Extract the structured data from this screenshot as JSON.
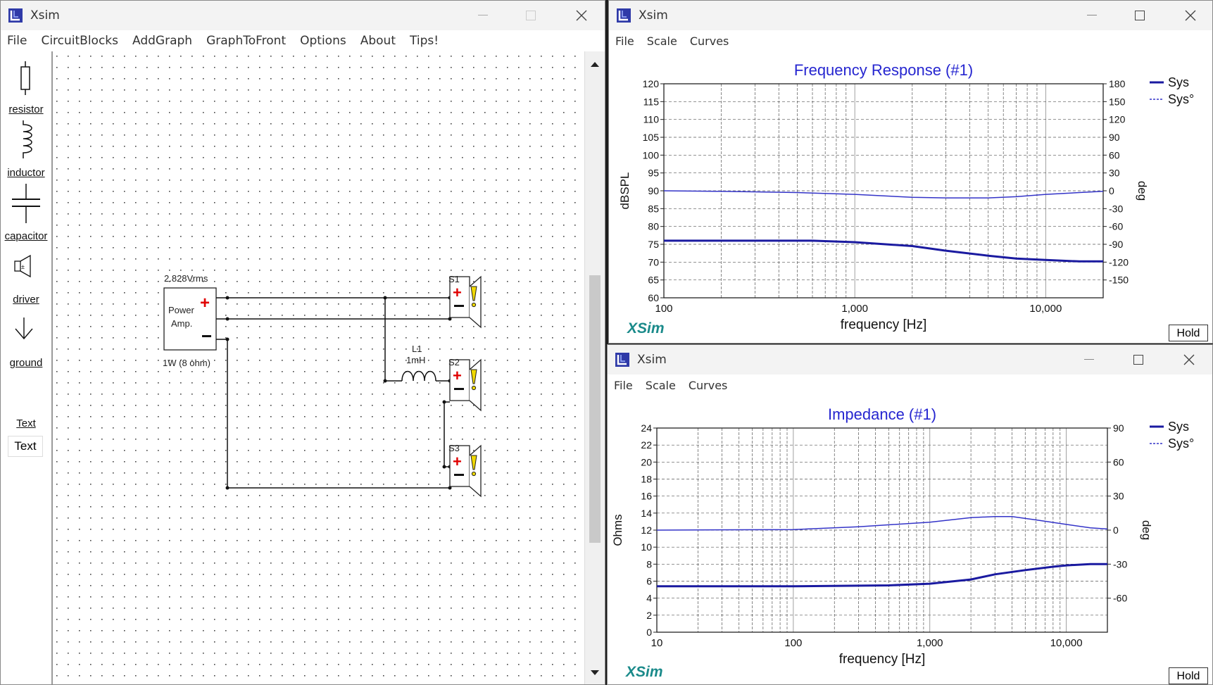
{
  "schematic": {
    "title": "Xsim",
    "menu": [
      "File",
      "CircuitBlocks",
      "AddGraph",
      "GraphToFront",
      "Options",
      "About",
      "Tips!"
    ],
    "palette": [
      {
        "label": "resistor",
        "icon": "resistor-icon"
      },
      {
        "label": "inductor",
        "icon": "inductor-icon"
      },
      {
        "label": "capacitor",
        "icon": "capacitor-icon"
      },
      {
        "label": "driver",
        "icon": "driver-icon"
      },
      {
        "label": "ground",
        "icon": "ground-icon"
      },
      {
        "label": "Text",
        "icon": "text-box"
      },
      {
        "label": "Text",
        "icon": ""
      }
    ],
    "amp": {
      "voltage": "2.828Vrms",
      "line1": "Power",
      "line2": "Amp.",
      "power": "1W (8 ohm)"
    },
    "inductor": {
      "name": "L1",
      "value": "1mH"
    },
    "speakers": [
      "S1",
      "S2",
      "S3"
    ]
  },
  "freq_window": {
    "title": "Xsim",
    "menu": [
      "File",
      "Scale",
      "Curves"
    ],
    "hold_label": "Hold",
    "brand": "XSim"
  },
  "imp_window": {
    "title": "Xsim",
    "menu": [
      "File",
      "Scale",
      "Curves"
    ],
    "hold_label": "Hold",
    "brand": "XSim"
  },
  "chart_data": [
    {
      "type": "line",
      "title": "Frequency Response (#1)",
      "xlabel": "frequency [Hz]",
      "ylabel": "dBSPL",
      "y2label": "deg",
      "xscale": "log",
      "xlim": [
        100,
        20000
      ],
      "ylim": [
        60,
        120
      ],
      "y2lim": [
        -180,
        180
      ],
      "xticks": [
        100,
        1000,
        10000
      ],
      "xtick_labels": [
        "100",
        "1,000",
        "10,000"
      ],
      "yticks": [
        60,
        65,
        70,
        75,
        80,
        85,
        90,
        95,
        100,
        105,
        110,
        115,
        120
      ],
      "y2ticks": [
        -150,
        -120,
        -90,
        -60,
        -30,
        0,
        30,
        60,
        90,
        120,
        150,
        180
      ],
      "grid": true,
      "legend": "top-right",
      "series": [
        {
          "name": "Sys",
          "axis": "left",
          "style": "solid",
          "color": "#1a1aa0",
          "x": [
            100,
            300,
            600,
            1000,
            2000,
            3000,
            5000,
            7000,
            10000,
            15000,
            20000
          ],
          "y": [
            76,
            76,
            76,
            75.6,
            74.5,
            73.2,
            71.8,
            71.0,
            70.6,
            70.2,
            70.2
          ]
        },
        {
          "name": "Sys°",
          "axis": "right",
          "style": "dashed",
          "color": "#3333c8",
          "x": [
            100,
            200,
            500,
            1000,
            2000,
            3000,
            5000,
            7000,
            10000,
            15000,
            20000
          ],
          "y": [
            0,
            -1,
            -3,
            -6,
            -11,
            -12,
            -12,
            -10,
            -6,
            -3,
            -1
          ]
        }
      ]
    },
    {
      "type": "line",
      "title": "Impedance (#1)",
      "xlabel": "frequency [Hz]",
      "ylabel": "Ohms",
      "y2label": "deg",
      "xscale": "log",
      "xlim": [
        10,
        20000
      ],
      "ylim": [
        0,
        24
      ],
      "y2lim": [
        -90,
        90
      ],
      "xticks": [
        10,
        100,
        1000,
        10000
      ],
      "xtick_labels": [
        "10",
        "100",
        "1,000",
        "10,000"
      ],
      "yticks": [
        0,
        2,
        4,
        6,
        8,
        10,
        12,
        14,
        16,
        18,
        20,
        22,
        24
      ],
      "y2ticks": [
        -60,
        -30,
        0,
        30,
        60,
        90
      ],
      "grid": true,
      "legend": "top-right",
      "series": [
        {
          "name": "Sys",
          "axis": "left",
          "style": "solid",
          "color": "#1a1aa0",
          "x": [
            10,
            100,
            500,
            1000,
            2000,
            3000,
            5000,
            8000,
            10000,
            15000,
            20000
          ],
          "y": [
            5.4,
            5.4,
            5.5,
            5.7,
            6.2,
            6.8,
            7.3,
            7.7,
            7.85,
            8.0,
            8.0
          ]
        },
        {
          "name": "Sys°",
          "axis": "right",
          "style": "dashed",
          "color": "#3333c8",
          "x": [
            10,
            100,
            300,
            1000,
            2000,
            3000,
            4000,
            6000,
            10000,
            15000,
            20000
          ],
          "y": [
            0,
            0.5,
            3,
            7,
            11,
            12,
            12,
            9,
            5,
            2,
            1
          ]
        }
      ]
    }
  ]
}
